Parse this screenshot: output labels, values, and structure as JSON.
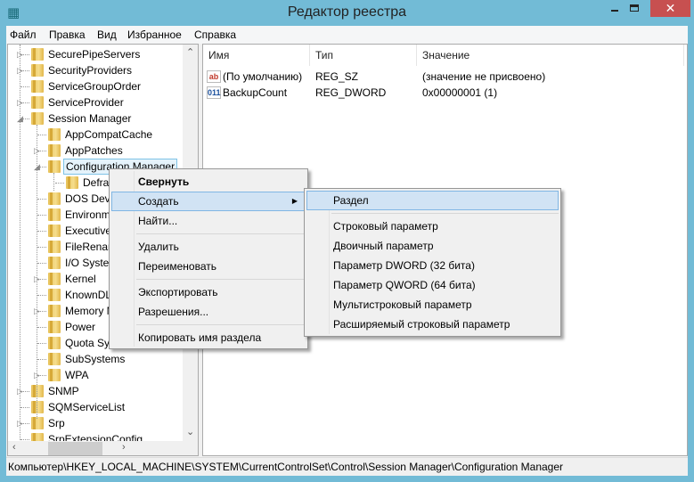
{
  "window": {
    "title": "Редактор реестра",
    "controls": {
      "minimize": "minimize",
      "maximize": "maximize",
      "close": "✕"
    }
  },
  "menubar": [
    "Файл",
    "Правка",
    "Вид",
    "Избранное",
    "Справка"
  ],
  "tree": [
    {
      "label": "SecurePipeServers",
      "level": 1,
      "state": "collapsed"
    },
    {
      "label": "SecurityProviders",
      "level": 1,
      "state": "collapsed"
    },
    {
      "label": "ServiceGroupOrder",
      "level": 1,
      "state": "leaf"
    },
    {
      "label": "ServiceProvider",
      "level": 1,
      "state": "collapsed"
    },
    {
      "label": "Session Manager",
      "level": 1,
      "state": "expanded"
    },
    {
      "label": "AppCompatCache",
      "level": 2,
      "state": "leaf"
    },
    {
      "label": "AppPatches",
      "level": 2,
      "state": "collapsed"
    },
    {
      "label": "Configuration Manager",
      "level": 2,
      "state": "expanded",
      "selected": true
    },
    {
      "label": "Defragmentation",
      "level": 3,
      "state": "leaf"
    },
    {
      "label": "DOS Devices",
      "level": 2,
      "state": "leaf"
    },
    {
      "label": "Environment",
      "level": 2,
      "state": "leaf"
    },
    {
      "label": "Executive",
      "level": 2,
      "state": "leaf"
    },
    {
      "label": "FileRenameOperations",
      "level": 2,
      "state": "leaf"
    },
    {
      "label": "I/O System",
      "level": 2,
      "state": "leaf"
    },
    {
      "label": "Kernel",
      "level": 2,
      "state": "collapsed"
    },
    {
      "label": "KnownDLLs",
      "level": 2,
      "state": "leaf"
    },
    {
      "label": "Memory Management",
      "level": 2,
      "state": "collapsed"
    },
    {
      "label": "Power",
      "level": 2,
      "state": "leaf"
    },
    {
      "label": "Quota System",
      "level": 2,
      "state": "leaf"
    },
    {
      "label": "SubSystems",
      "level": 2,
      "state": "leaf"
    },
    {
      "label": "WPA",
      "level": 2,
      "state": "collapsed"
    },
    {
      "label": "SNMP",
      "level": 1,
      "state": "collapsed"
    },
    {
      "label": "SQMServiceList",
      "level": 1,
      "state": "leaf"
    },
    {
      "label": "Srp",
      "level": 1,
      "state": "collapsed"
    },
    {
      "label": "SrpExtensionConfig",
      "level": 1,
      "state": "leaf"
    }
  ],
  "list": {
    "columns": [
      "Имя",
      "Тип",
      "Значение"
    ],
    "rows": [
      {
        "icon": "string-value-icon",
        "icon_text": "ab",
        "name": "(По умолчанию)",
        "type": "REG_SZ",
        "value": "(значение не присвоено)"
      },
      {
        "icon": "binary-value-icon",
        "icon_text": "011",
        "name": "BackupCount",
        "type": "REG_DWORD",
        "value": "0x00000001 (1)"
      }
    ]
  },
  "context_menu": {
    "items": [
      {
        "label": "Свернуть",
        "bold": true
      },
      {
        "label": "Создать",
        "submenu": true,
        "highlighted": true
      },
      {
        "label": "Найти..."
      },
      {
        "separator": true
      },
      {
        "label": "Удалить"
      },
      {
        "label": "Переименовать"
      },
      {
        "separator": true
      },
      {
        "label": "Экспортировать"
      },
      {
        "label": "Разрешения..."
      },
      {
        "separator": true
      },
      {
        "label": "Копировать имя раздела"
      }
    ]
  },
  "submenu": {
    "items": [
      {
        "label": "Раздел",
        "highlighted": true
      },
      {
        "separator": true
      },
      {
        "label": "Строковый параметр"
      },
      {
        "label": "Двоичный параметр"
      },
      {
        "label": "Параметр DWORD (32 бита)"
      },
      {
        "label": "Параметр QWORD (64 бита)"
      },
      {
        "label": "Мультистроковый параметр"
      },
      {
        "label": "Расширяемый строковый параметр"
      }
    ]
  },
  "status": "Компьютер\\HKEY_LOCAL_MACHINE\\SYSTEM\\CurrentControlSet\\Control\\Session Manager\\Configuration Manager",
  "colors": {
    "frame": "#72bbd6",
    "close": "#c75050",
    "highlight": "#d1e3f4",
    "selection": "#e5f3fb"
  }
}
